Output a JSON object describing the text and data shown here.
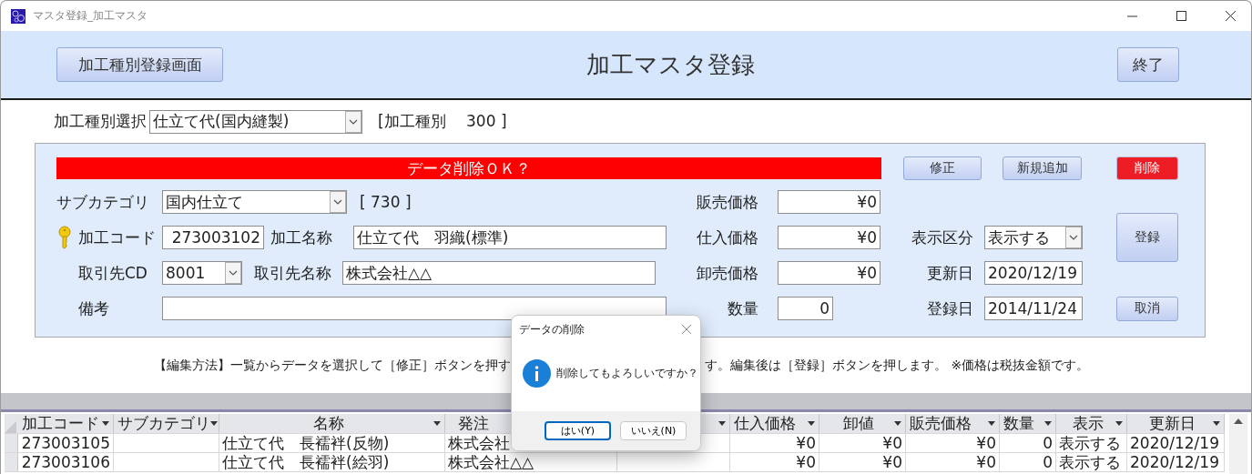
{
  "window": {
    "title": "マスタ登録_加工マスタ"
  },
  "header": {
    "nav_button": "加工種別登録画面",
    "title": "加工マスタ登録",
    "exit_button": "終了"
  },
  "type_select": {
    "label": "加工種別選択",
    "value": "仕立て代(国内縫製)",
    "info": "[加工種別　 300 ]"
  },
  "form": {
    "alert": "データ削除ＯＫ？",
    "actions": [
      {
        "label": "修正",
        "kind": "normal"
      },
      {
        "label": "新規追加",
        "kind": "normal"
      },
      {
        "label": "削除",
        "kind": "danger"
      }
    ],
    "left_rows": [
      [
        {
          "label": "サブカテゴリ",
          "kind": "combo",
          "value": "国内仕立て"
        },
        {
          "kind": "note",
          "text": "[ 730 ]"
        }
      ],
      [
        {
          "label": "加工コード",
          "kind": "number",
          "value": "273003102",
          "key": true
        },
        {
          "label": "加工名称",
          "kind": "text",
          "value": "仕立て代　羽織(標準)"
        }
      ],
      [
        {
          "label": "取引先CD",
          "kind": "combo",
          "value": "8001"
        },
        {
          "label": "取引先名称",
          "kind": "text",
          "value": "株式会社△△"
        }
      ],
      [
        {
          "label": "備考",
          "kind": "text"
        }
      ]
    ],
    "price_fields": [
      {
        "label": "販売価格",
        "value": "¥0"
      },
      {
        "label": "仕入価格",
        "value": "¥0"
      },
      {
        "label": "卸売価格",
        "value": "¥0"
      },
      {
        "label": "数量",
        "value": "0"
      }
    ],
    "status_fields": [
      {
        "label": "表示区分",
        "kind": "combo",
        "value": "表示する"
      },
      {
        "label": "更新日",
        "kind": "date",
        "value": "2020/12/19"
      },
      {
        "label": "登録日",
        "kind": "date",
        "value": "2014/11/24"
      }
    ],
    "side_buttons": [
      "登録",
      "取消"
    ]
  },
  "instructions": {
    "left": "【編集方法】一覧からデータを選択して［修正］ボタンを押す",
    "right": "す。編集後は［登録］ボタンを押します。 ※価格は税抜金額です。"
  },
  "table": {
    "columns": [
      "加工コード",
      "サブカテゴリ",
      "名称",
      "発注",
      null,
      "仕入価格",
      "卸値",
      "販売価格",
      "数量",
      "表示",
      "更新日"
    ],
    "rows": [
      {
        "cells": [
          "273003105",
          "",
          "仕立て代　長襦袢(反物)",
          "株式会社",
          "",
          "¥0",
          "¥0",
          "¥0",
          "0",
          "表示する",
          "2020/12/19"
        ]
      },
      {
        "cells": [
          "273003106",
          "",
          "仕立て代　長襦袢(絵羽)",
          "株式会社△△",
          "",
          "¥0",
          "¥0",
          "¥0",
          "0",
          "表示する",
          "2020/12/19"
        ]
      }
    ]
  },
  "dialog": {
    "title": "データの削除",
    "message": "削除してもよろしいですか？",
    "buttons": [
      {
        "label": "はい(Y)",
        "default": true
      },
      {
        "label": "いいえ(N)",
        "default": false
      }
    ]
  }
}
